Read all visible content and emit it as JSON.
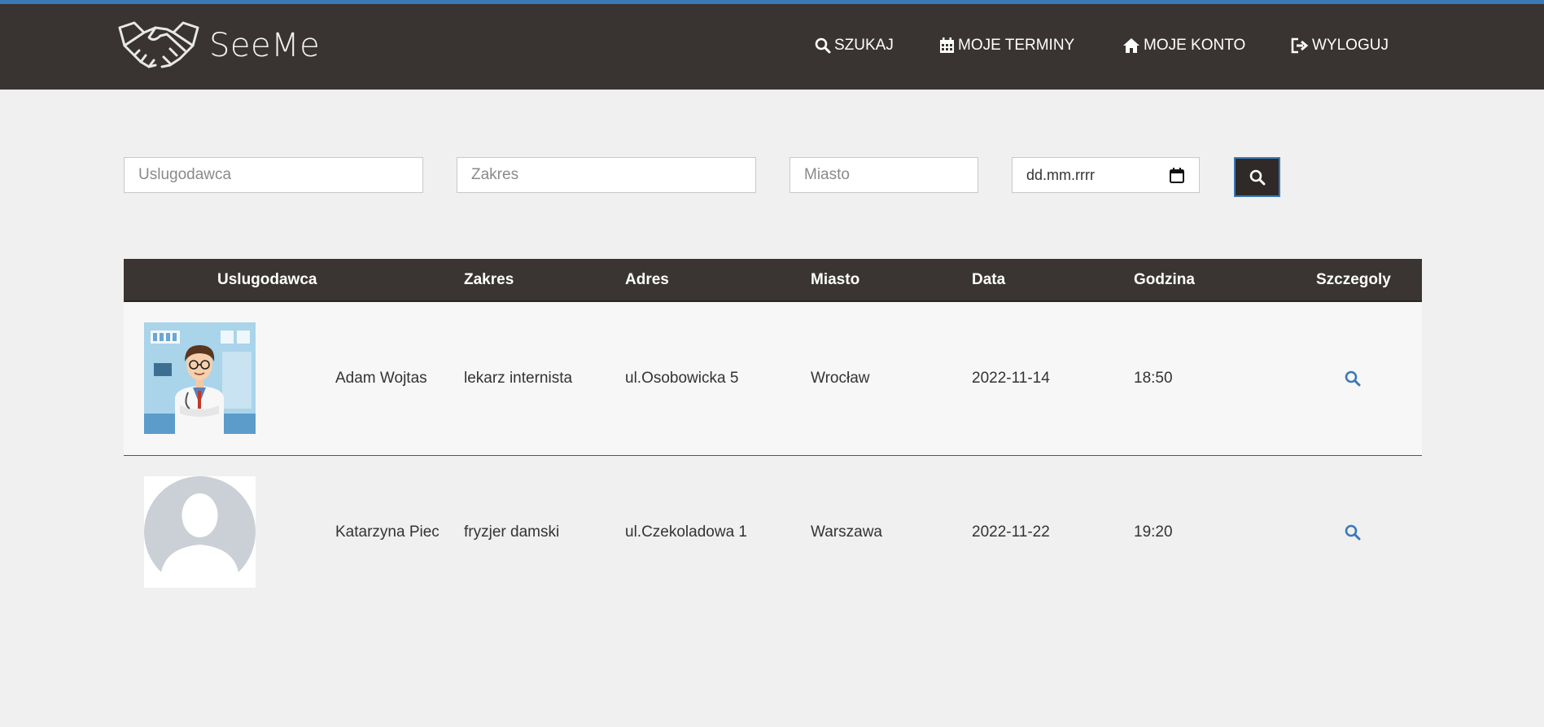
{
  "brand": {
    "name": "SeeMe",
    "logo_icon": "handshake-icon"
  },
  "nav": [
    {
      "label": "SZUKAJ",
      "icon": "search-icon"
    },
    {
      "label": "MOJE TERMINY",
      "icon": "calendar-icon"
    },
    {
      "label": "MOJE KONTO",
      "icon": "home-icon"
    },
    {
      "label": "WYLOGUJ",
      "icon": "logout-icon"
    }
  ],
  "search": {
    "provider_placeholder": "Uslugodawca",
    "scope_placeholder": "Zakres",
    "city_placeholder": "Miasto",
    "date_placeholder": "dd.mm.rrrr",
    "button_icon": "search-icon"
  },
  "table": {
    "headers": [
      "Uslugodawca",
      "Zakres",
      "Adres",
      "Miasto",
      "Data",
      "Godzina",
      "Szczegoly"
    ],
    "rows": [
      {
        "avatar": "doctor-avatar",
        "name": "Adam Wojtas",
        "scope": "lekarz internista",
        "address": "ul.Osobowicka 5",
        "city": "Wrocław",
        "date": "2022-11-14",
        "time": "18:50",
        "detail_icon": "search-icon"
      },
      {
        "avatar": "default-avatar",
        "name": "Katarzyna Piec",
        "scope": "fryzjer damski",
        "address": "ul.Czekoladowa 1",
        "city": "Warszawa",
        "date": "2022-11-22",
        "time": "19:20",
        "detail_icon": "search-icon"
      }
    ]
  },
  "colors": {
    "navbar": "#393431",
    "accent": "#3a78b8",
    "page_bg": "#f0f0f0",
    "detail_icon": "#3a78b8"
  }
}
